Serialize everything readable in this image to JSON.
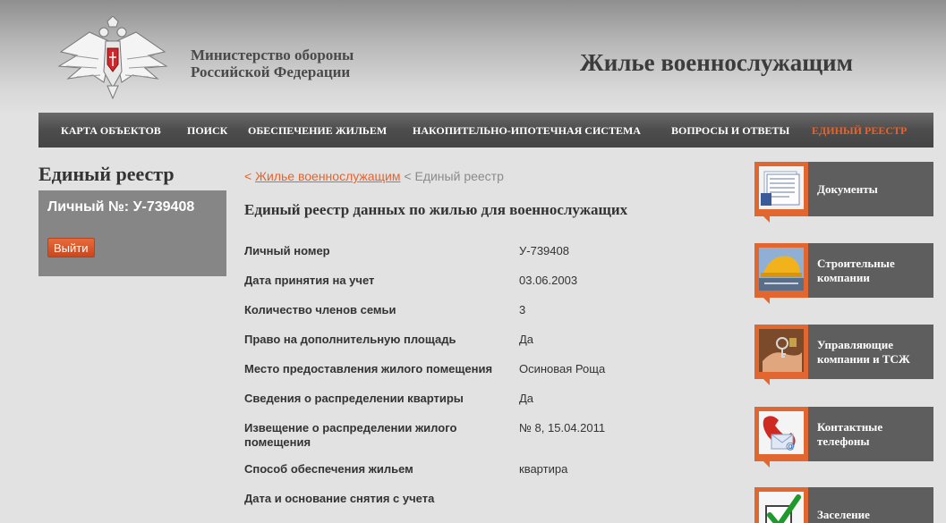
{
  "header": {
    "ministry_line1": "Министерство обороны",
    "ministry_line2": "Российской Федерации",
    "site_title": "Жилье военнослужащим",
    "emblem_icon": "double-headed-eagle-emblem-icon"
  },
  "nav": {
    "items": [
      {
        "label": "КАРТА ОБЪЕКТОВ"
      },
      {
        "label": "ПОИСК"
      },
      {
        "label": "ОБЕСПЕЧЕНИЕ ЖИЛЬЕМ"
      },
      {
        "label": "НАКОПИТЕЛЬНО-ИПОТЕЧНАЯ СИСТЕМА"
      },
      {
        "label": "ВОПРОСЫ И ОТВЕТЫ"
      },
      {
        "label": "ЕДИНЫЙ РЕЕСТР"
      }
    ],
    "active_label": "ЕДИНЫЙ РЕЕСТР"
  },
  "sidebar": {
    "title": "Единый реестр",
    "user_number": "Личный №: У-739408",
    "logout_label": "Выйти"
  },
  "breadcrumb": {
    "separator": "<",
    "link": "Жилье военнослужащим",
    "current": "Единый реестр"
  },
  "main": {
    "heading": "Единый реестр данных по жилью для военнослужащих",
    "rows": [
      {
        "label": "Личный номер",
        "value": "У-739408"
      },
      {
        "label": "Дата принятия на учет",
        "value": "03.06.2003"
      },
      {
        "label": "Количество членов семьи",
        "value": "3"
      },
      {
        "label": "Право на дополнительную площадь",
        "value": "Да"
      },
      {
        "label": "Место предоставления жилого помещения",
        "value": "Осиновая Роща"
      },
      {
        "label": "Сведения о распределении квартиры",
        "value": "Да"
      },
      {
        "label": "Извещение о распределении жилого помещения",
        "value": "№ 8, 15.04.2011"
      },
      {
        "label": "Способ обеспечения жильем",
        "value": "квартира"
      },
      {
        "label": "Дата и основание снятия с учета",
        "value": ""
      }
    ]
  },
  "right_panel": {
    "tiles": [
      {
        "label": "Документы",
        "icon": "documents-stack-icon"
      },
      {
        "label": "Строительные компании",
        "icon": "construction-helmet-icon"
      },
      {
        "label": "Управляющие компании и ТСЖ",
        "icon": "keys-in-hand-icon"
      },
      {
        "label": "Контактные телефоны",
        "icon": "phone-mail-icon"
      },
      {
        "label": "Заселение",
        "icon": "checkmark-box-icon"
      }
    ]
  },
  "colors": {
    "accent": "#e8622b",
    "nav_bg": "#4d4d4d",
    "sidebar_box": "#868686",
    "tile_text_bg": "#5e5e5e",
    "page_bg": "#e2e2e2"
  }
}
